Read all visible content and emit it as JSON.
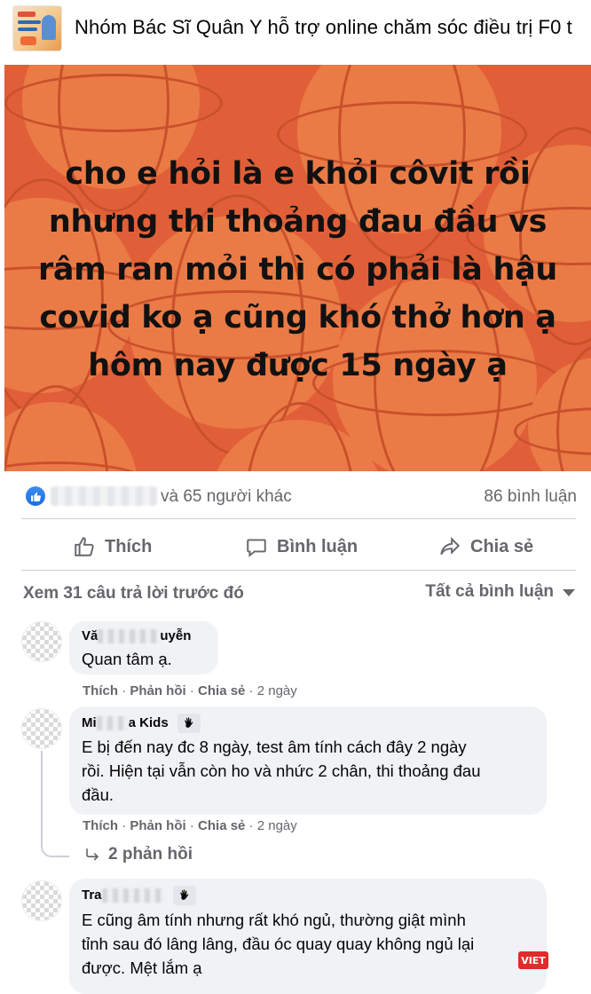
{
  "group": {
    "title": "Nhóm Bác Sĩ Quân Y hỗ trợ online chăm sóc điều trị F0 t"
  },
  "post": {
    "lines": [
      "cho e hỏi là e khỏi côvit rồi",
      "nhưng thi thoảng đau đầu vs",
      "râm ran mỏi thì có phải là hậu",
      "covid ko ạ cũng khó thở hơn ạ",
      "hôm nay được 15 ngày ạ"
    ],
    "background_color": "#e15f38",
    "reactions_text": "và 65 người khác",
    "comment_count": "86 bình luận"
  },
  "actions": {
    "like": "Thích",
    "comment": "Bình luận",
    "share": "Chia sẻ"
  },
  "comments_header": {
    "view_previous": "Xem 31 câu trả lời trước đó",
    "filter": "Tất cả bình luận"
  },
  "comments": [
    {
      "author_visible": "Vă",
      "author_tail": "uyễn",
      "text": "Quan tâm ạ.",
      "like": "Thích",
      "reply": "Phản hồi",
      "share": "Chia sẻ",
      "time": "2 ngày"
    },
    {
      "author_visible": "Mi",
      "author_tail": "a Kids",
      "text_lines": [
        "E bị đến nay đc 8 ngày, test âm tính cách đây 2 ngày",
        "rồi. Hiện tại vẫn còn ho và nhức 2 chân, thi thoảng đau",
        "đầu."
      ],
      "like": "Thích",
      "reply": "Phản hồi",
      "share": "Chia sẻ",
      "time": "2 ngày",
      "replies": "2 phản hồi"
    },
    {
      "author_visible": "Tra",
      "author_tail": "",
      "text_lines": [
        "E cũng âm tính nhưng rất khó ngủ, thường giật mình",
        "tỉnh sau đó lâng lâng, đầu óc quay quay không ngủ lại",
        "được. Mệt lắm ạ"
      ]
    }
  ],
  "watermark": "VIET"
}
